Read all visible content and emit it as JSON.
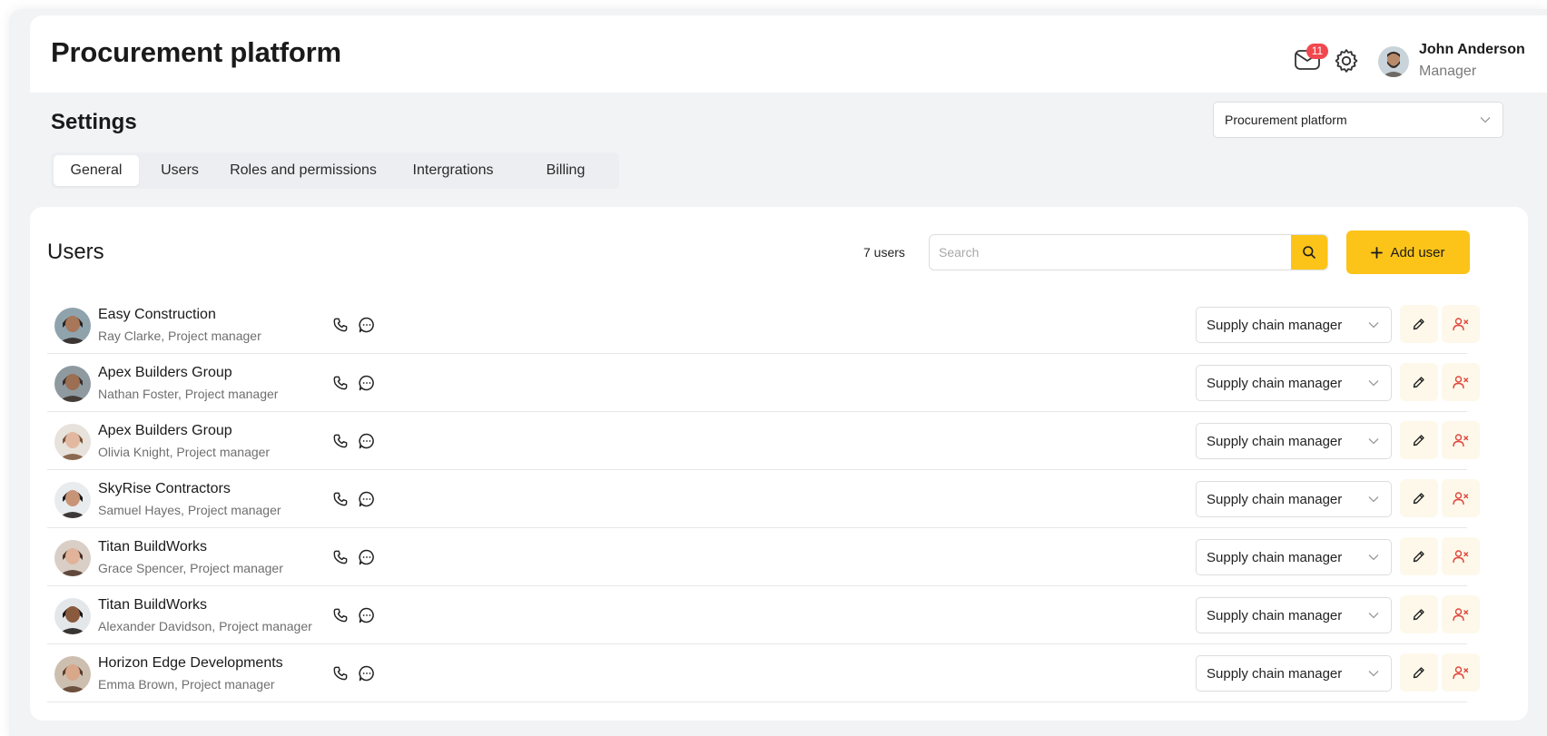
{
  "header": {
    "title": "Procurement platform",
    "notifications_count": "11",
    "user": {
      "name": "John Anderson",
      "role": "Manager"
    }
  },
  "settings": {
    "title": "Settings",
    "platform_select": "Procurement platform",
    "tabs": [
      {
        "label": "General",
        "active": true
      },
      {
        "label": "Users",
        "active": false
      },
      {
        "label": "Roles and permissions",
        "active": false
      },
      {
        "label": "Intergrations",
        "active": false
      },
      {
        "label": "Billing",
        "active": false
      }
    ]
  },
  "users_panel": {
    "title": "Users",
    "count_label": "7 users",
    "search_placeholder": "Search",
    "add_button": "Add user",
    "rows": [
      {
        "company": "Easy Construction",
        "person": "Ray Clarke, Project manager",
        "role": "Supply chain manager"
      },
      {
        "company": "Apex Builders Group",
        "person": "Nathan Foster, Project manager",
        "role": "Supply chain manager"
      },
      {
        "company": "Apex Builders Group",
        "person": "Olivia Knight, Project manager",
        "role": "Supply chain manager"
      },
      {
        "company": "SkyRise Contractors",
        "person": "Samuel Hayes, Project manager",
        "role": "Supply chain manager"
      },
      {
        "company": "Titan BuildWorks",
        "person": "Grace Spencer, Project manager",
        "role": "Supply chain manager"
      },
      {
        "company": "Titan BuildWorks",
        "person": "Alexander Davidson, Project manager",
        "role": "Supply chain manager"
      },
      {
        "company": "Horizon Edge Developments",
        "person": "Emma Brown, Project manager",
        "role": "Supply chain manager"
      }
    ]
  },
  "colors": {
    "accent": "#fcc419",
    "badge": "#f0484e",
    "danger_icon": "#e0463c",
    "action_bg": "#fdf8ea"
  },
  "icons": [
    "mail-icon",
    "gear-icon",
    "chevron-down-icon",
    "search-icon",
    "plus-icon",
    "phone-icon",
    "chat-icon",
    "edit-icon",
    "remove-user-icon"
  ]
}
